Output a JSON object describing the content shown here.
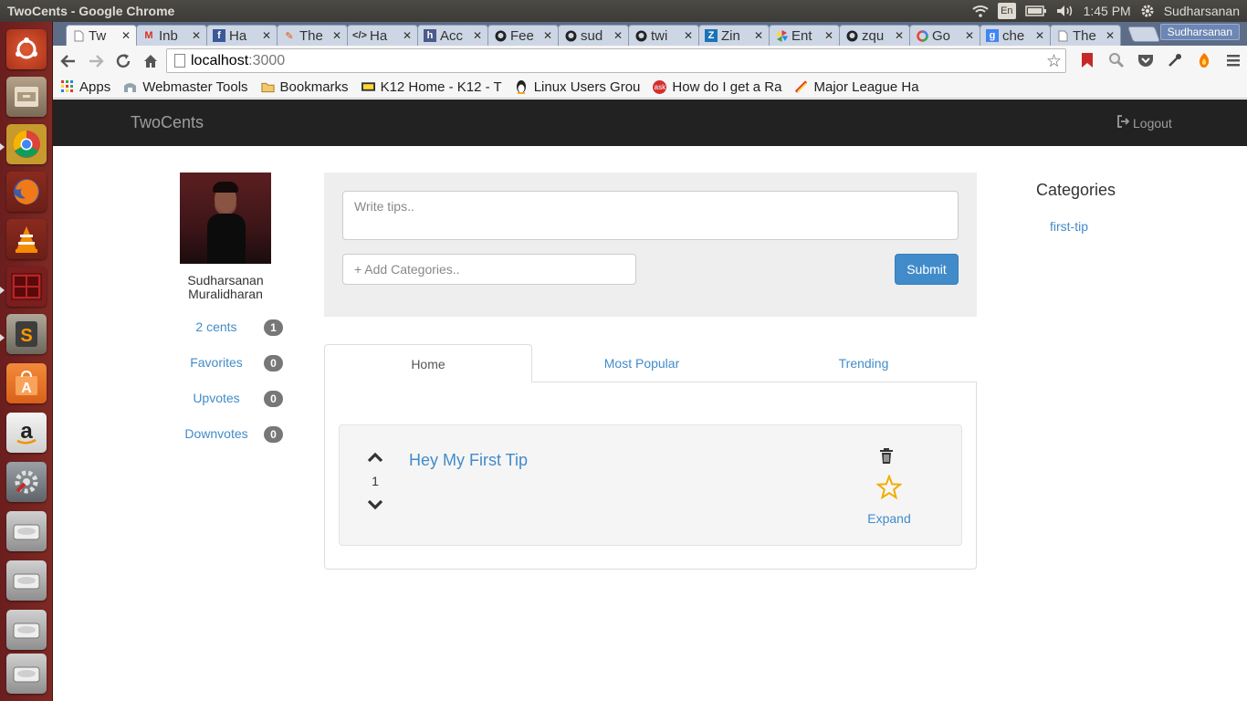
{
  "os": {
    "window_title": "TwoCents - Google Chrome",
    "lang": "En",
    "time": "1:45 PM",
    "user": "Sudharsanan"
  },
  "browser": {
    "tabs": [
      {
        "label": "Tw",
        "icon": "page-icon",
        "active": true
      },
      {
        "label": "Inb",
        "icon": "gmail-icon"
      },
      {
        "label": "Ha",
        "icon": "facebook-icon"
      },
      {
        "label": "The",
        "icon": "rocket-icon"
      },
      {
        "label": "Ha",
        "icon": "code-icon"
      },
      {
        "label": "Acc",
        "icon": "hackathon-icon"
      },
      {
        "label": "Fee",
        "icon": "github-icon"
      },
      {
        "label": "sud",
        "icon": "github-icon"
      },
      {
        "label": "twi",
        "icon": "github-icon"
      },
      {
        "label": "Zin",
        "icon": "zimbra-icon"
      },
      {
        "label": "Ent",
        "icon": "pinwheel-icon"
      },
      {
        "label": "zqu",
        "icon": "github-icon"
      },
      {
        "label": "Go",
        "icon": "google-icon"
      },
      {
        "label": "che",
        "icon": "google-search-icon"
      },
      {
        "label": "The",
        "icon": "page-icon"
      }
    ],
    "profile_name": "Sudharsanan",
    "url_host": "localhost",
    "url_port": ":3000",
    "bookmarks": [
      {
        "label": "Apps",
        "icon": "apps-grid-icon"
      },
      {
        "label": "Webmaster Tools",
        "icon": "webmaster-icon"
      },
      {
        "label": "Bookmarks",
        "icon": "folder-icon"
      },
      {
        "label": "K12 Home - K12 - T",
        "icon": "k12-icon"
      },
      {
        "label": "Linux Users Grou",
        "icon": "tux-icon"
      },
      {
        "label": "How do I get a Ra",
        "icon": "ask-icon"
      },
      {
        "label": "Major League Ha",
        "icon": "mlh-icon"
      }
    ]
  },
  "app": {
    "brand": "TwoCents",
    "logout": "Logout",
    "user": {
      "name_line1": "Sudharsanan",
      "name_line2": "Muralidharan"
    },
    "stats": [
      {
        "label": "2 cents",
        "count": "1"
      },
      {
        "label": "Favorites",
        "count": "0"
      },
      {
        "label": "Upvotes",
        "count": "0"
      },
      {
        "label": "Downvotes",
        "count": "0"
      }
    ],
    "compose": {
      "tip_placeholder": "Write tips..",
      "category_placeholder": "+ Add Categories..",
      "submit": "Submit"
    },
    "tabs": [
      {
        "label": "Home",
        "active": true
      },
      {
        "label": "Most Popular"
      },
      {
        "label": "Trending"
      }
    ],
    "tips": [
      {
        "title": "Hey My First Tip",
        "votes": "1",
        "expand": "Expand"
      }
    ],
    "categories": {
      "heading": "Categories",
      "items": [
        "first-tip"
      ]
    },
    "colors": {
      "link": "#428bca",
      "navbar": "#222222",
      "badge": "#777777",
      "star": "#f0ad00"
    }
  }
}
